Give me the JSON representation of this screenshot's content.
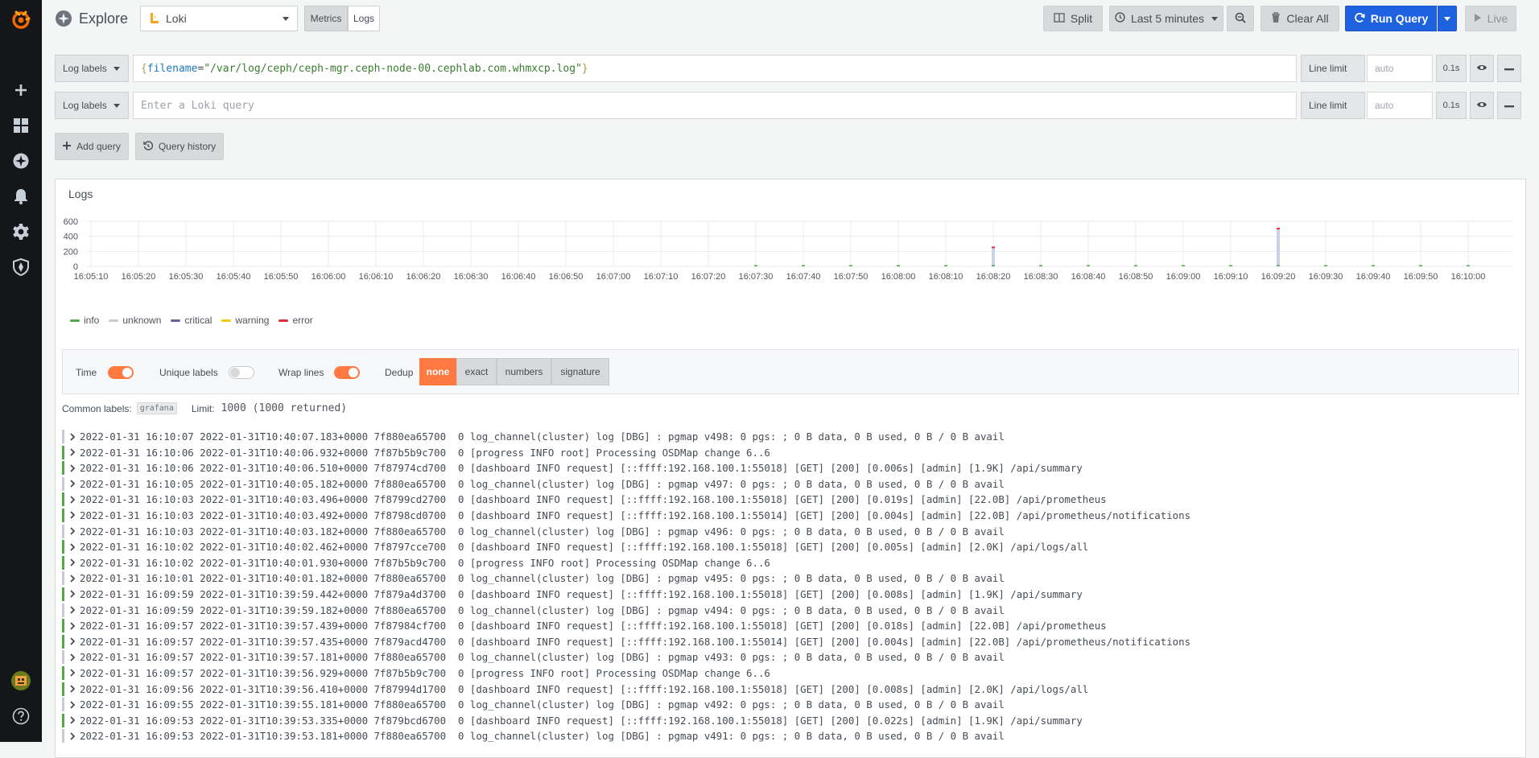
{
  "header": {
    "title": "Explore",
    "datasource": "Loki",
    "modes": [
      "Metrics",
      "Logs"
    ],
    "active_mode": "Logs",
    "split": "Split",
    "time_range": "Last 5 minutes",
    "clear_all": "Clear All",
    "run_query": "Run Query",
    "live": "Live"
  },
  "queries": [
    {
      "selector": "Log labels",
      "query_open": "{",
      "query_key": "filename",
      "query_eq": "=",
      "query_value": "\"/var/log/ceph/ceph-mgr.ceph-node-00.cephlab.com.whmxcp.log\"",
      "query_close": "}",
      "line_limit_label": "Line limit",
      "line_limit_placeholder": "auto",
      "time": "0.1s"
    },
    {
      "selector": "Log labels",
      "placeholder": "Enter a Loki query",
      "line_limit_label": "Line limit",
      "line_limit_placeholder": "auto",
      "time": "0.1s"
    }
  ],
  "actions": {
    "add_query": "Add query",
    "query_history": "Query history"
  },
  "logs_panel": {
    "title": "Logs",
    "options": {
      "time_label": "Time",
      "time_on": true,
      "unique_label": "Unique labels",
      "unique_on": false,
      "wrap_label": "Wrap lines",
      "wrap_on": true,
      "dedup_label": "Dedup",
      "dedup_options": [
        "none",
        "exact",
        "numbers",
        "signature"
      ],
      "dedup_selected": "none"
    },
    "common_labels_label": "Common labels:",
    "common_label_value": "grafana",
    "limit_label": "Limit:",
    "limit_value": "1000 (1000 returned)"
  },
  "chart_data": {
    "type": "bar",
    "title": "",
    "ylim": [
      0,
      600
    ],
    "y_ticks": [
      "600",
      "400",
      "200",
      "0"
    ],
    "x_ticks": [
      "16:05:10",
      "16:05:20",
      "16:05:30",
      "16:05:40",
      "16:05:50",
      "16:06:00",
      "16:06:10",
      "16:06:20",
      "16:06:30",
      "16:06:40",
      "16:06:50",
      "16:07:00",
      "16:07:10",
      "16:07:20",
      "16:07:30",
      "16:07:40",
      "16:07:50",
      "16:08:00",
      "16:08:10",
      "16:08:20",
      "16:08:30",
      "16:08:40",
      "16:08:50",
      "16:09:00",
      "16:09:10",
      "16:09:20",
      "16:09:30",
      "16:09:40",
      "16:09:50",
      "16:10:00"
    ],
    "grid": true,
    "legend_position": "bottom-left",
    "series": [
      {
        "name": "info",
        "color": "#56a64b"
      },
      {
        "name": "unknown",
        "color": "#c8ccd2"
      },
      {
        "name": "critical",
        "color": "#705da0"
      },
      {
        "name": "warning",
        "color": "#f2cc0c"
      },
      {
        "name": "error",
        "color": "#e02f44"
      }
    ],
    "bars": [
      {
        "t": "16:07:30",
        "info": 2,
        "unknown": 0,
        "error": 0
      },
      {
        "t": "16:07:40",
        "info": 8,
        "unknown": 0,
        "error": 0
      },
      {
        "t": "16:07:50",
        "info": 4,
        "unknown": 0,
        "error": 0
      },
      {
        "t": "16:08:00",
        "info": 4,
        "unknown": 0,
        "error": 0
      },
      {
        "t": "16:08:10",
        "info": 14,
        "unknown": 0,
        "error": 0
      },
      {
        "t": "16:08:20",
        "info": 4,
        "unknown": 226,
        "error": 20
      },
      {
        "t": "16:08:30",
        "info": 4,
        "unknown": 0,
        "error": 0
      },
      {
        "t": "16:08:40",
        "info": 8,
        "unknown": 0,
        "error": 0
      },
      {
        "t": "16:08:50",
        "info": 4,
        "unknown": 0,
        "error": 0
      },
      {
        "t": "16:09:00",
        "info": 6,
        "unknown": 0,
        "error": 0
      },
      {
        "t": "16:09:10",
        "info": 12,
        "unknown": 0,
        "error": 0
      },
      {
        "t": "16:09:20",
        "info": 4,
        "unknown": 476,
        "error": 20
      },
      {
        "t": "16:09:30",
        "info": 4,
        "unknown": 0,
        "error": 0
      },
      {
        "t": "16:09:40",
        "info": 8,
        "unknown": 0,
        "error": 0
      },
      {
        "t": "16:09:50",
        "info": 4,
        "unknown": 0,
        "error": 0
      },
      {
        "t": "16:10:00",
        "info": 4,
        "unknown": 0,
        "error": 0
      }
    ]
  },
  "log_rows": [
    {
      "level": "unknown",
      "text": "2022-01-31 16:10:07 2022-01-31T10:40:07.183+0000 7f880ea65700  0 log_channel(cluster) log [DBG] : pgmap v498: 0 pgs: ; 0 B data, 0 B used, 0 B / 0 B avail"
    },
    {
      "level": "info",
      "text": "2022-01-31 16:10:06 2022-01-31T10:40:06.932+0000 7f87b5b9c700  0 [progress INFO root] Processing OSDMap change 6..6"
    },
    {
      "level": "info",
      "text": "2022-01-31 16:10:06 2022-01-31T10:40:06.510+0000 7f87974cd700  0 [dashboard INFO request] [::ffff:192.168.100.1:55018] [GET] [200] [0.006s] [admin] [1.9K] /api/summary"
    },
    {
      "level": "unknown",
      "text": "2022-01-31 16:10:05 2022-01-31T10:40:05.182+0000 7f880ea65700  0 log_channel(cluster) log [DBG] : pgmap v497: 0 pgs: ; 0 B data, 0 B used, 0 B / 0 B avail"
    },
    {
      "level": "info",
      "text": "2022-01-31 16:10:03 2022-01-31T10:40:03.496+0000 7f8799cd2700  0 [dashboard INFO request] [::ffff:192.168.100.1:55018] [GET] [200] [0.019s] [admin] [22.0B] /api/prometheus"
    },
    {
      "level": "info",
      "text": "2022-01-31 16:10:03 2022-01-31T10:40:03.492+0000 7f8798cd0700  0 [dashboard INFO request] [::ffff:192.168.100.1:55014] [GET] [200] [0.004s] [admin] [22.0B] /api/prometheus/notifications"
    },
    {
      "level": "unknown",
      "text": "2022-01-31 16:10:03 2022-01-31T10:40:03.182+0000 7f880ea65700  0 log_channel(cluster) log [DBG] : pgmap v496: 0 pgs: ; 0 B data, 0 B used, 0 B / 0 B avail"
    },
    {
      "level": "info",
      "text": "2022-01-31 16:10:02 2022-01-31T10:40:02.462+0000 7f8797cce700  0 [dashboard INFO request] [::ffff:192.168.100.1:55018] [GET] [200] [0.005s] [admin] [2.0K] /api/logs/all"
    },
    {
      "level": "info",
      "text": "2022-01-31 16:10:02 2022-01-31T10:40:01.930+0000 7f87b5b9c700  0 [progress INFO root] Processing OSDMap change 6..6"
    },
    {
      "level": "unknown",
      "text": "2022-01-31 16:10:01 2022-01-31T10:40:01.182+0000 7f880ea65700  0 log_channel(cluster) log [DBG] : pgmap v495: 0 pgs: ; 0 B data, 0 B used, 0 B / 0 B avail"
    },
    {
      "level": "info",
      "text": "2022-01-31 16:09:59 2022-01-31T10:39:59.442+0000 7f879a4d3700  0 [dashboard INFO request] [::ffff:192.168.100.1:55018] [GET] [200] [0.008s] [admin] [1.9K] /api/summary"
    },
    {
      "level": "unknown",
      "text": "2022-01-31 16:09:59 2022-01-31T10:39:59.182+0000 7f880ea65700  0 log_channel(cluster) log [DBG] : pgmap v494: 0 pgs: ; 0 B data, 0 B used, 0 B / 0 B avail"
    },
    {
      "level": "info",
      "text": "2022-01-31 16:09:57 2022-01-31T10:39:57.439+0000 7f87984cf700  0 [dashboard INFO request] [::ffff:192.168.100.1:55018] [GET] [200] [0.018s] [admin] [22.0B] /api/prometheus"
    },
    {
      "level": "info",
      "text": "2022-01-31 16:09:57 2022-01-31T10:39:57.435+0000 7f879acd4700  0 [dashboard INFO request] [::ffff:192.168.100.1:55014] [GET] [200] [0.004s] [admin] [22.0B] /api/prometheus/notifications"
    },
    {
      "level": "unknown",
      "text": "2022-01-31 16:09:57 2022-01-31T10:39:57.181+0000 7f880ea65700  0 log_channel(cluster) log [DBG] : pgmap v493: 0 pgs: ; 0 B data, 0 B used, 0 B / 0 B avail"
    },
    {
      "level": "info",
      "text": "2022-01-31 16:09:57 2022-01-31T10:39:56.929+0000 7f87b5b9c700  0 [progress INFO root] Processing OSDMap change 6..6"
    },
    {
      "level": "info",
      "text": "2022-01-31 16:09:56 2022-01-31T10:39:56.410+0000 7f87994d1700  0 [dashboard INFO request] [::ffff:192.168.100.1:55018] [GET] [200] [0.008s] [admin] [2.0K] /api/logs/all"
    },
    {
      "level": "unknown",
      "text": "2022-01-31 16:09:55 2022-01-31T10:39:55.181+0000 7f880ea65700  0 log_channel(cluster) log [DBG] : pgmap v492: 0 pgs: ; 0 B data, 0 B used, 0 B / 0 B avail"
    },
    {
      "level": "info",
      "text": "2022-01-31 16:09:53 2022-01-31T10:39:53.335+0000 7f879bcd6700  0 [dashboard INFO request] [::ffff:192.168.100.1:55018] [GET] [200] [0.022s] [admin] [1.9K] /api/summary"
    },
    {
      "level": "unknown",
      "text": "2022-01-31 16:09:53 2022-01-31T10:39:53.181+0000 7f880ea65700  0 log_channel(cluster) log [DBG] : pgmap v491: 0 pgs: ; 0 B data, 0 B used, 0 B / 0 B avail"
    }
  ],
  "colors": {
    "accent_orange": "#ff7941",
    "brand_blue": "#1f62e0",
    "info": "#56a64b",
    "unknown": "#c8ccd2"
  },
  "sidebar": {
    "icons": [
      "grafana-logo-icon",
      "plus-icon",
      "dashboards-icon",
      "explore-icon",
      "bell-icon",
      "gear-icon",
      "shield-icon",
      "avatar",
      "help-icon"
    ]
  }
}
